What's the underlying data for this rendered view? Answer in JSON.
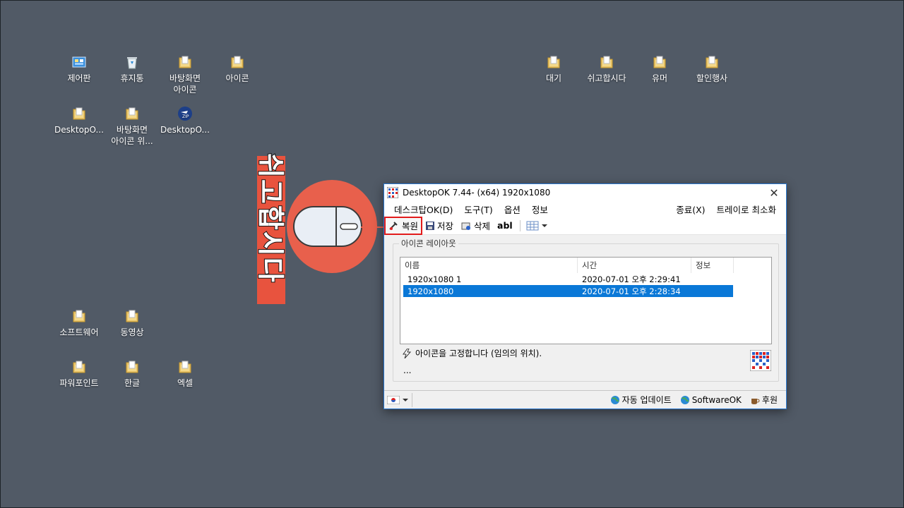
{
  "desktop": {
    "icons": [
      {
        "label": "제어판",
        "icon": "control-panel-icon"
      },
      {
        "label": "휴지통",
        "icon": "recycle-bin-icon"
      },
      {
        "label": "바탕화면\n아이콘",
        "icon": "folder-icon"
      },
      {
        "label": "아이콘",
        "icon": "folder-icon"
      },
      {
        "label": "DesktopO...",
        "icon": "folder-icon"
      },
      {
        "label": "바탕화면\n아이콘 위...",
        "icon": "folder-icon"
      },
      {
        "label": "DesktopO...",
        "icon": "zip-icon"
      },
      {
        "label": "대기",
        "icon": "folder-icon"
      },
      {
        "label": "쉬고합시다",
        "icon": "folder-icon"
      },
      {
        "label": "유머",
        "icon": "folder-icon"
      },
      {
        "label": "할인행사",
        "icon": "folder-icon"
      },
      {
        "label": "소프트웨어",
        "icon": "folder-icon"
      },
      {
        "label": "동영상",
        "icon": "folder-icon"
      },
      {
        "label": "파워포인트",
        "icon": "folder-icon"
      },
      {
        "label": "한글",
        "icon": "folder-icon"
      },
      {
        "label": "엑셀",
        "icon": "folder-icon"
      }
    ]
  },
  "overlay": {
    "banner_text": "쉬고합시다",
    "accent": "#e8533e"
  },
  "window": {
    "title": "DesktopOK 7.44- (x64) 1920x1080",
    "close_glyph": "✕",
    "menu": {
      "desktopok": "데스크탑OK(D)",
      "tools": "도구(T)",
      "options": "옵션",
      "info": "정보",
      "exit": "종료(X)",
      "tray": "트레이로 최소화"
    },
    "toolbar": {
      "restore": "복원",
      "save": "저장",
      "delete": "삭제",
      "rename": "abl"
    },
    "group_title": "아이콘 레이아웃",
    "columns": {
      "name": "이름",
      "time": "시간",
      "info": "정보"
    },
    "rows": [
      {
        "name": "1920x1080 1",
        "time": "2020-07-01 오후 2:29:41",
        "selected": false
      },
      {
        "name": "1920x1080",
        "time": "2020-07-01 오후 2:28:34",
        "selected": true
      }
    ],
    "lock_text": "아이콘을 고정합니다 (임의의 위치).",
    "dots": "...",
    "status": {
      "auto_update": "자동 업데이트",
      "softwareok": "SoftwareOK",
      "donate": "후원"
    }
  }
}
